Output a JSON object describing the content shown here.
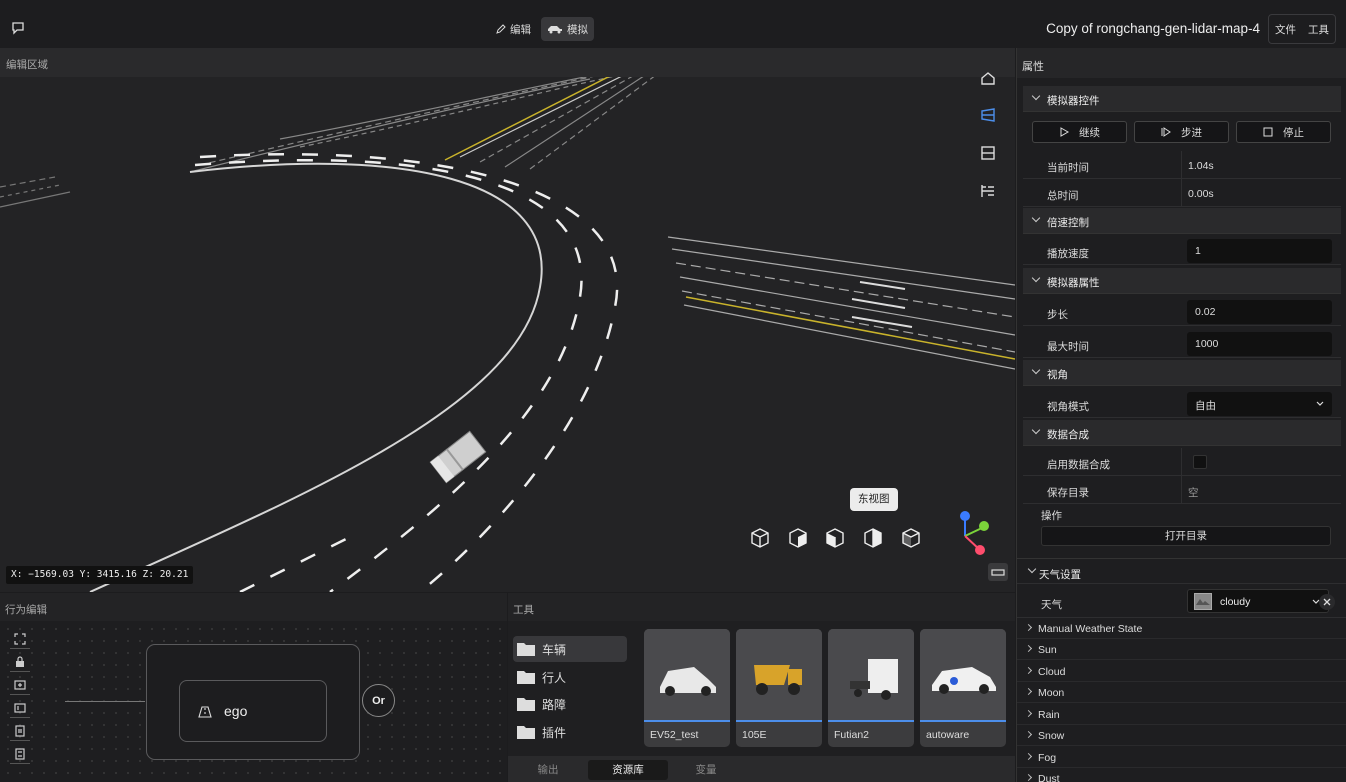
{
  "topbar": {
    "mode_edit_label": "编辑",
    "mode_sim_label": "模拟",
    "document_title": "Copy of rongchang-gen-lidar-map-4",
    "menu_file": "文件",
    "menu_tools": "工具"
  },
  "viewport": {
    "tab_label": "编辑区域",
    "coordinates": "X: −1569.03 Y: 3415.16 Z: 20.21",
    "tooltip": "东视图",
    "tool_icons": [
      "home-icon",
      "perspective-icon",
      "ortho-icon",
      "layers-icon"
    ],
    "view_cubes": [
      "iso-view-icon",
      "front-view-icon",
      "side-view-icon",
      "east-view-icon",
      "back-view-icon"
    ],
    "axis_colors": {
      "x": "#ff4d6d",
      "y": "#7bd33a",
      "z": "#3a7bff"
    }
  },
  "behavior": {
    "tab_label": "行为编辑",
    "node_label": "ego",
    "or_label": "Or",
    "toolbar_icons": [
      "fit-view-icon",
      "lock-icon",
      "add-node-icon",
      "insert-node-icon",
      "copy-node-icon",
      "paste-node-icon"
    ]
  },
  "tools": {
    "tab_label": "工具",
    "folders": [
      "车辆",
      "行人",
      "路障",
      "插件"
    ],
    "assets": [
      "EV52_test",
      "105E",
      "Futian2",
      "autoware"
    ],
    "bottom_tabs": [
      "输出",
      "资源库",
      "变量"
    ]
  },
  "properties": {
    "tab_label": "属性",
    "sim_controls": {
      "title": "模拟器控件",
      "continue": "继续",
      "step": "步进",
      "stop": "停止",
      "current_time_label": "当前时间",
      "current_time_value": "1.04s",
      "total_time_label": "总时间",
      "total_time_value": "0.00s"
    },
    "speed": {
      "title": "倍速控制",
      "playback_label": "播放速度",
      "playback_value": "1"
    },
    "sim_props": {
      "title": "模拟器属性",
      "step_label": "步长",
      "step_value": "0.02",
      "max_time_label": "最大时间",
      "max_time_value": "1000"
    },
    "view": {
      "title": "视角",
      "mode_label": "视角模式",
      "mode_value": "自由"
    },
    "data_synth": {
      "title": "数据合成",
      "enable_label": "启用数据合成",
      "save_dir_label": "保存目录",
      "save_dir_value": "空",
      "ops_label": "操作",
      "open_dir": "打开目录"
    },
    "weather": {
      "title": "天气设置",
      "label": "天气",
      "value": "cloudy"
    },
    "collapsibles": [
      "Manual Weather State",
      "Sun",
      "Cloud",
      "Moon",
      "Rain",
      "Snow",
      "Fog",
      "Dust"
    ]
  }
}
